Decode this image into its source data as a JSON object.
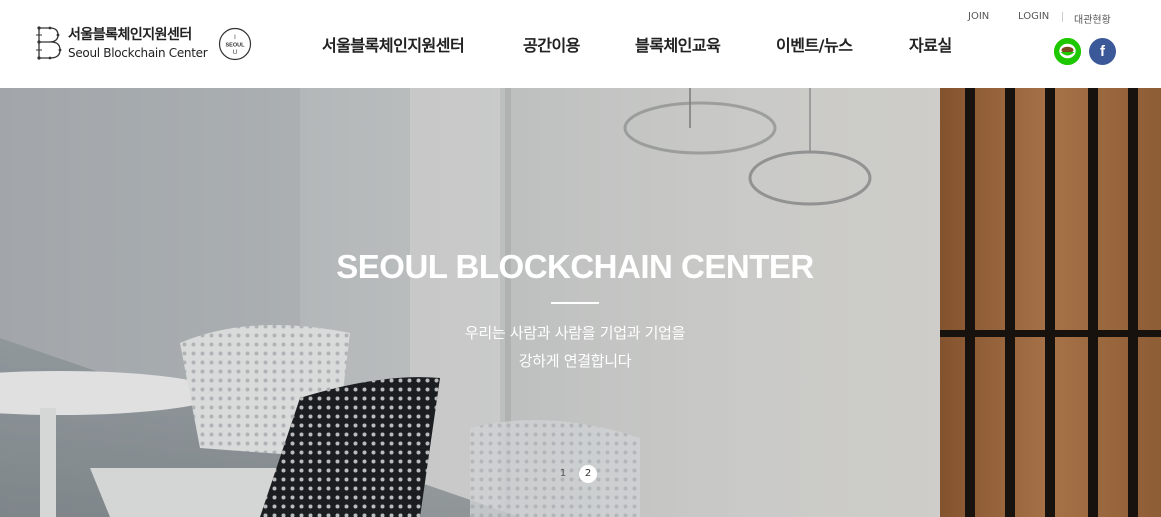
{
  "header": {
    "logo": {
      "korean": "서울블록체인지원센터",
      "english": "Seoul Blockchain Center",
      "seal_top": "I",
      "seal_mid": "SEOUL",
      "seal_bottom": "U"
    },
    "nav": [
      {
        "label": "서울블록체인지원센터"
      },
      {
        "label": "공간이용"
      },
      {
        "label": "블록체인교육"
      },
      {
        "label": "이벤트/뉴스"
      },
      {
        "label": "자료실"
      }
    ],
    "utility": {
      "join": "JOIN",
      "login": "LOGIN",
      "rental": "대관현황"
    },
    "social": [
      {
        "icon": "naver-blog-icon",
        "color": "#1ec800"
      },
      {
        "icon": "facebook-icon",
        "label": "f",
        "color": "#3b5998"
      }
    ]
  },
  "hero": {
    "title": "SEOUL BLOCKCHAIN CENTER",
    "subtitle_line1": "우리는 사람과 사람을 기업과 기업을",
    "subtitle_line2": "강하게 연결합니다",
    "pager": [
      {
        "label": "1",
        "active": false
      },
      {
        "label": "2",
        "active": true
      }
    ]
  }
}
